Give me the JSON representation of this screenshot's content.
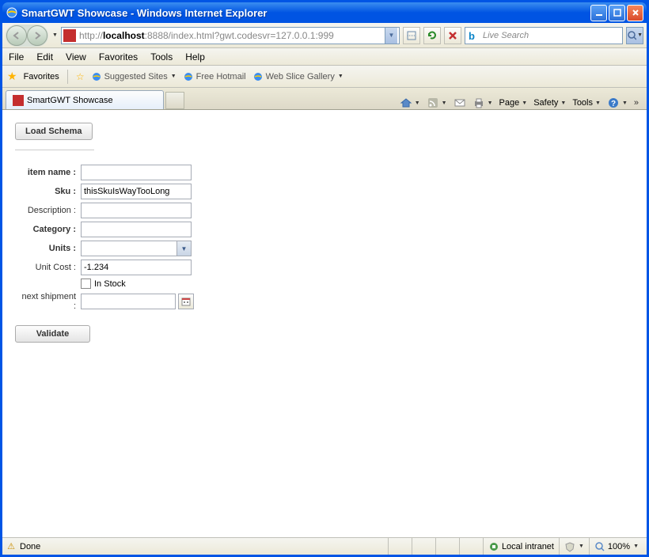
{
  "window": {
    "title": "SmartGWT Showcase - Windows Internet Explorer"
  },
  "address": {
    "prefix": "http://",
    "host": "localhost",
    "port_path": ":8888/index.html?gwt.codesvr=127.0.0.1:999"
  },
  "search": {
    "placeholder": "Live Search"
  },
  "menu": {
    "file": "File",
    "edit": "Edit",
    "view": "View",
    "favorites": "Favorites",
    "tools": "Tools",
    "help": "Help"
  },
  "favbar": {
    "favorites": "Favorites",
    "suggested": "Suggested Sites",
    "hotmail": "Free Hotmail",
    "webslice": "Web Slice Gallery"
  },
  "tab": {
    "title": "SmartGWT Showcase"
  },
  "tabtools": {
    "page": "Page",
    "safety": "Safety",
    "tools": "Tools"
  },
  "buttons": {
    "load_schema": "Load Schema",
    "validate": "Validate"
  },
  "form": {
    "item_name_label": "item name :",
    "item_name_value": "",
    "sku_label": "Sku :",
    "sku_value": "thisSkuIsWayTooLong",
    "description_label": "Description :",
    "description_value": "",
    "category_label": "Category :",
    "category_value": "",
    "units_label": "Units :",
    "units_value": "",
    "unit_cost_label": "Unit Cost :",
    "unit_cost_value": "-1.234",
    "in_stock_label": "In Stock",
    "next_shipment_label": "next shipment :",
    "next_shipment_value": ""
  },
  "status": {
    "done": "Done",
    "zone": "Local intranet",
    "zoom": "100%"
  }
}
